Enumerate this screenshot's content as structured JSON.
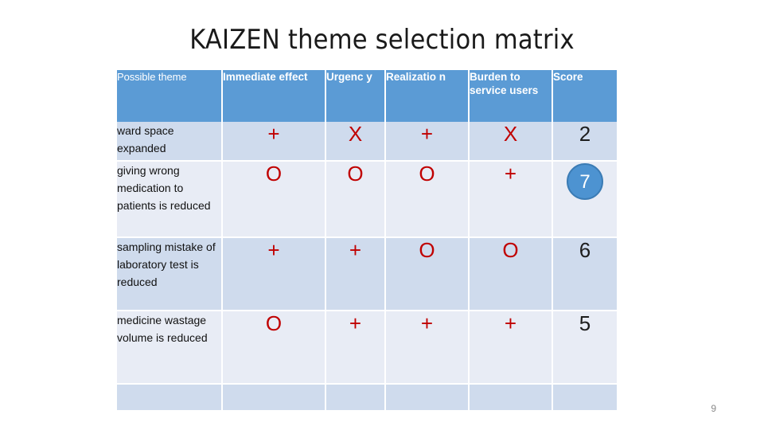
{
  "slide": {
    "title": "KAIZEN theme selection matrix",
    "page_number": "9",
    "colors": {
      "header_blue": "#5b9bd5",
      "row_dark": "#cfdbed",
      "row_light": "#e8ecf5",
      "mark_red": "#c00000",
      "bubble_blue": "#4d93d1",
      "bubble_border": "#3b7cb5",
      "title_text": "#1a1a1a",
      "page_number_text": "#8a8a8a"
    }
  },
  "table": {
    "headers": [
      {
        "label": "Possible theme",
        "style": "light"
      },
      {
        "label": "Immediate effect",
        "style": "bold"
      },
      {
        "label": "Urgenc y",
        "style": "bold"
      },
      {
        "label": "Realizatio n",
        "style": "bold"
      },
      {
        "label": "Burden to service users",
        "style": "bold"
      },
      {
        "label": "Score",
        "style": "bold"
      }
    ],
    "rows": [
      {
        "theme": "ward space expanded",
        "immediate_effect": "+",
        "urgency": "X",
        "realization": "+",
        "burden_to_service_users": "X",
        "score": "2",
        "score_highlighted": false,
        "shade": "dark"
      },
      {
        "theme": "giving wrong medication to patients is reduced",
        "immediate_effect": "O",
        "urgency": "O",
        "realization": "O",
        "burden_to_service_users": "+",
        "score": "7",
        "score_highlighted": true,
        "shade": "light"
      },
      {
        "theme": "sampling mistake of laboratory test is reduced",
        "immediate_effect": "+",
        "urgency": "+",
        "realization": "O",
        "burden_to_service_users": "O",
        "score": "6",
        "score_highlighted": false,
        "shade": "dark"
      },
      {
        "theme": "medicine wastage volume is reduced",
        "immediate_effect": "O",
        "urgency": "+",
        "realization": "+",
        "burden_to_service_users": "+",
        "score": "5",
        "score_highlighted": false,
        "shade": "light"
      },
      {
        "theme": "",
        "immediate_effect": "",
        "urgency": "",
        "realization": "",
        "burden_to_service_users": "",
        "score": "",
        "score_highlighted": false,
        "shade": "dark"
      }
    ]
  }
}
